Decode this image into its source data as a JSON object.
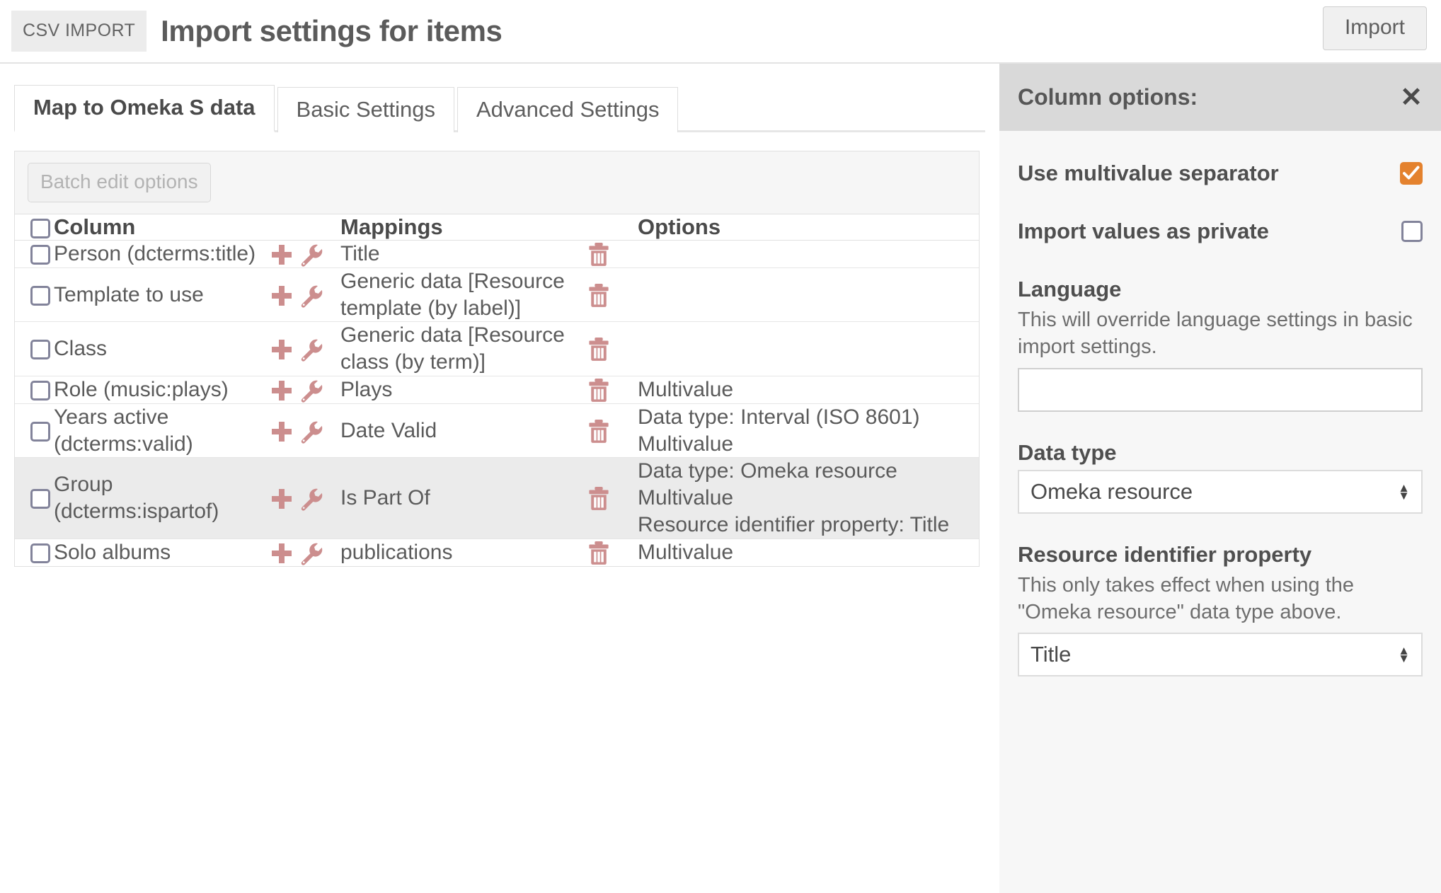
{
  "header": {
    "badge": "CSV IMPORT",
    "title": "Import settings for items",
    "import_button": "Import"
  },
  "tabs": [
    {
      "label": "Map to Omeka S data",
      "active": true
    },
    {
      "label": "Basic Settings",
      "active": false
    },
    {
      "label": "Advanced Settings",
      "active": false
    }
  ],
  "toolbar": {
    "batch_edit_label": "Batch edit options"
  },
  "table": {
    "headers": {
      "column": "Column",
      "mappings": "Mappings",
      "options": "Options"
    },
    "rows": [
      {
        "column": "Person (dcterms:title)",
        "mapping": "Title",
        "options": [],
        "highlight": false
      },
      {
        "column": "Template to use",
        "mapping": "Generic data [Resource template (by label)]",
        "options": [],
        "highlight": false
      },
      {
        "column": "Class",
        "mapping": "Generic data [Resource class (by term)]",
        "options": [],
        "highlight": false
      },
      {
        "column": "Role (music:plays)",
        "mapping": "Plays",
        "options": [
          "Multivalue"
        ],
        "highlight": false
      },
      {
        "column": "Years active (dcterms:valid)",
        "mapping": "Date Valid",
        "options": [
          "Data type: Interval (ISO 8601)",
          "Multivalue"
        ],
        "highlight": false
      },
      {
        "column": "Group (dcterms:ispartof)",
        "mapping": "Is Part Of",
        "options": [
          "Data type: Omeka resource",
          "Multivalue",
          "Resource identifier property: Title"
        ],
        "highlight": true
      },
      {
        "column": "Solo albums",
        "mapping": "publications",
        "options": [
          "Multivalue"
        ],
        "highlight": false
      }
    ]
  },
  "sidebar": {
    "title": "Column options:",
    "close_label": "✕",
    "multivalue": {
      "label": "Use multivalue separator",
      "checked": true
    },
    "private": {
      "label": "Import values as private",
      "checked": false
    },
    "language": {
      "label": "Language",
      "help": "This will override language settings in basic import settings.",
      "value": ""
    },
    "data_type": {
      "label": "Data type",
      "value": "Omeka resource"
    },
    "resource_identifier": {
      "label": "Resource identifier property",
      "help": "This only takes effect when using the \"Omeka resource\" data type above.",
      "value": "Title"
    }
  },
  "icons": {
    "add": "plus-icon",
    "edit": "wrench-icon",
    "remove": "trash-icon",
    "close": "close-icon",
    "spinner": "spinner-arrows-icon"
  },
  "colors": {
    "accent_orange": "#e4822e",
    "icon_red": "#cc8e8e",
    "text": "#5b5b5b",
    "panel_bg": "#f7f7f7",
    "panel_head": "#d9d9d9"
  }
}
